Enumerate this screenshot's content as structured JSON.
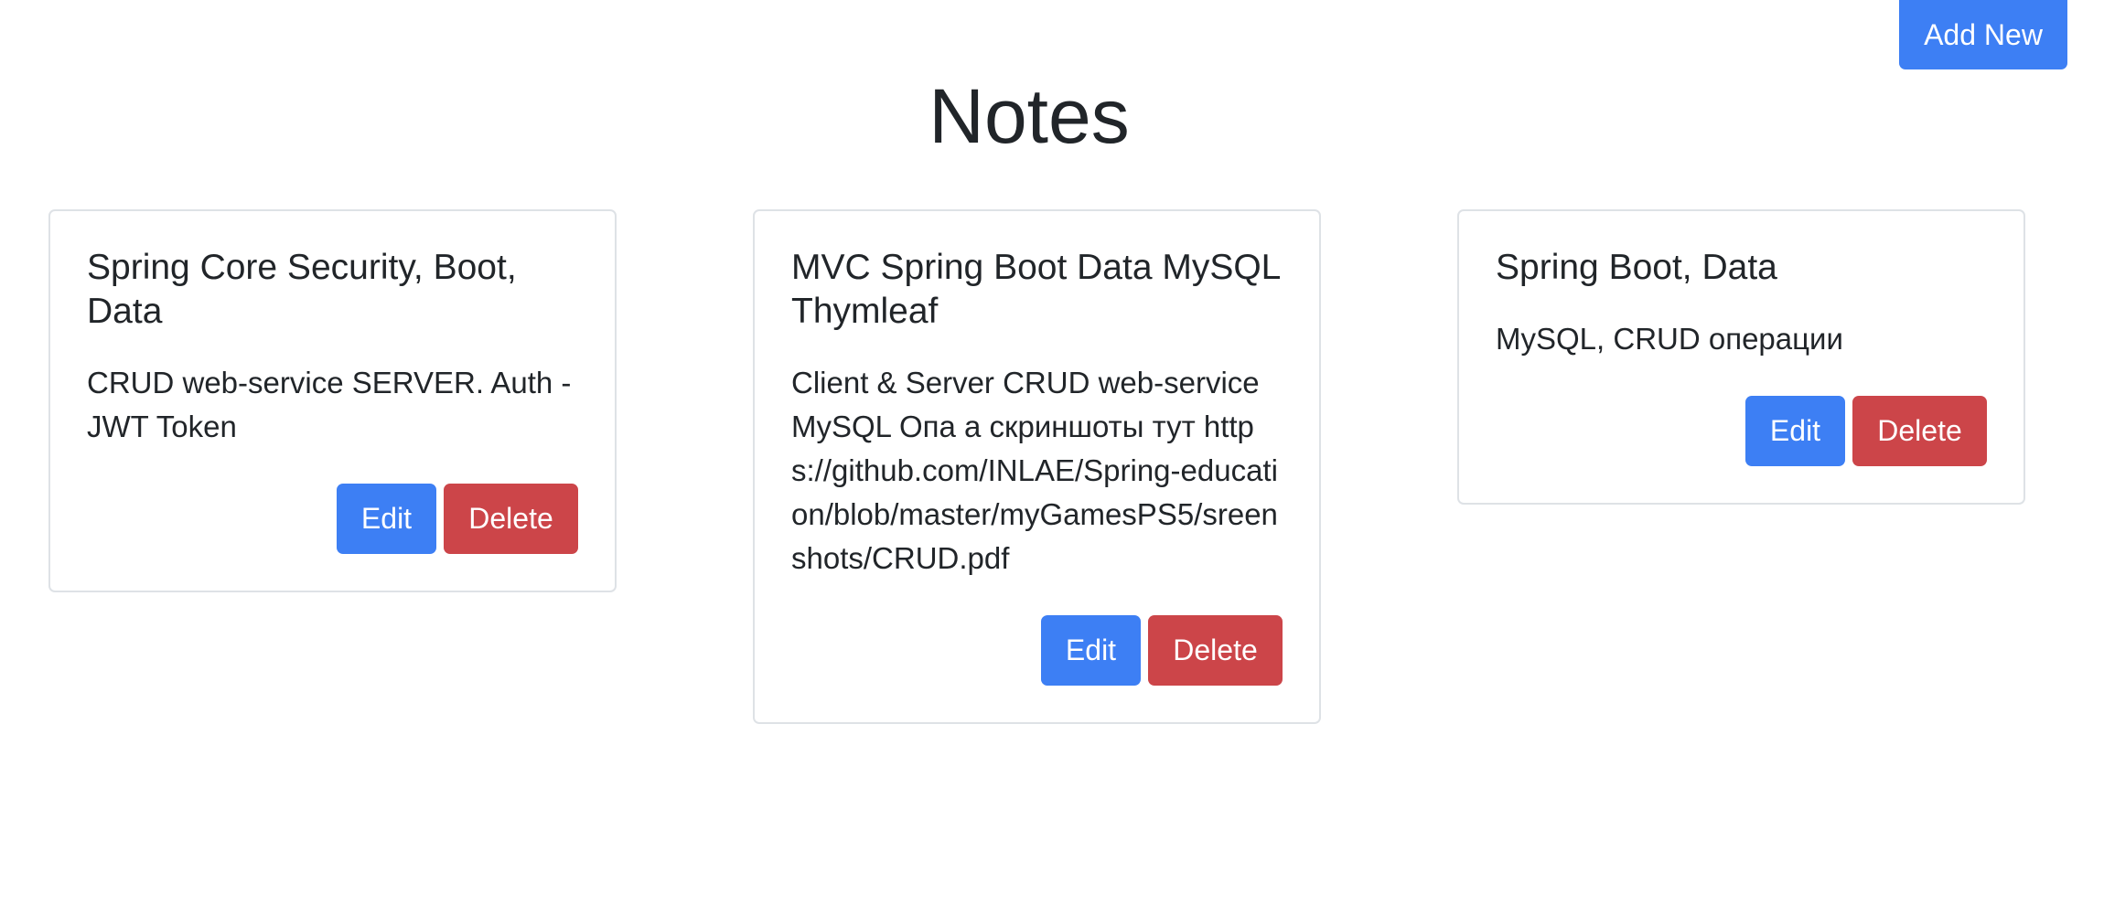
{
  "header": {
    "add_new_label": "Add New",
    "title": "Notes"
  },
  "notes": [
    {
      "title": "Spring Core Security, Boot, Data",
      "text": "CRUD web-service SERVER. Auth - JWT Token",
      "edit_label": "Edit",
      "delete_label": "Delete"
    },
    {
      "title": "MVC Spring Boot Data MySQL Thymleaf",
      "text": "Client & Server CRUD web-service MySQL Опа а скриншоты тут https://github.com/INLAE/Spring-education/blob/master/myGamesPS5/sreenshots/CRUD.pdf",
      "edit_label": "Edit",
      "delete_label": "Delete"
    },
    {
      "title": "Spring Boot, Data",
      "text": "MySQL, CRUD операции",
      "edit_label": "Edit",
      "delete_label": "Delete"
    }
  ],
  "colors": {
    "primary": "#3d7ff4",
    "danger": "#cc4549",
    "border": "#dee2e6",
    "text": "#212529"
  }
}
